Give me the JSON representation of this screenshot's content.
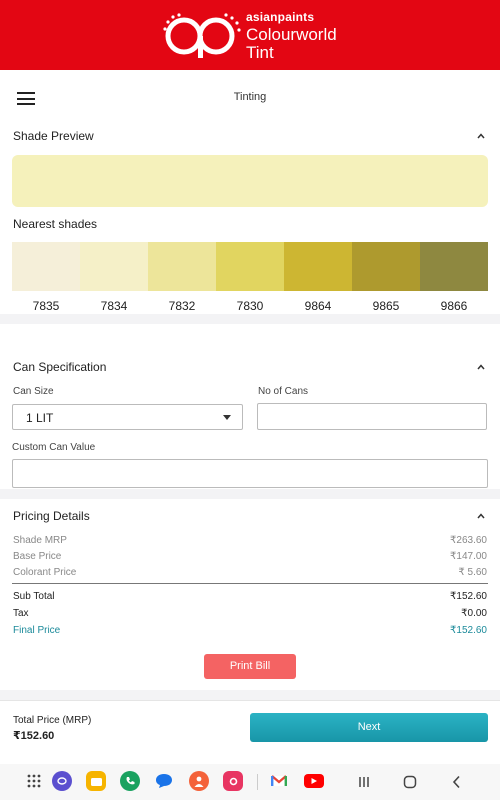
{
  "brand": {
    "line1": "asianpaints",
    "line2": "Colourworld",
    "line3": "Tint",
    "color": "#e30613"
  },
  "appbar": {
    "menu_icon": "hamburger-menu-icon",
    "title": "Tinting"
  },
  "shade_preview": {
    "heading": "Shade Preview",
    "collapse_icon": "chevron-up-icon",
    "preview_color": "#f5f1bb",
    "nearest_heading": "Nearest shades",
    "nearest_shades": [
      {
        "code": "7835",
        "color": "#f5efd9"
      },
      {
        "code": "7834",
        "color": "#f5f0c8"
      },
      {
        "code": "7832",
        "color": "#ede59a"
      },
      {
        "code": "7830",
        "color": "#e1d560"
      },
      {
        "code": "9864",
        "color": "#cdb632"
      },
      {
        "code": "9865",
        "color": "#ae9a2e"
      },
      {
        "code": "9866",
        "color": "#8e8840"
      }
    ]
  },
  "can_spec": {
    "heading": "Can Specification",
    "collapse_icon": "chevron-up-icon",
    "can_size_label": "Can Size",
    "can_size_value": "1 LIT",
    "no_of_cans_label": "No of Cans",
    "no_of_cans_value": "",
    "custom_label": "Custom Can Value",
    "custom_value": ""
  },
  "pricing": {
    "heading": "Pricing Details",
    "collapse_icon": "chevron-up-icon",
    "shade_mrp_label": "Shade MRP",
    "shade_mrp": "₹263.60",
    "base_price_label": "Base Price",
    "base_price": "₹147.00",
    "colorant_label": "Colorant Price",
    "colorant_price": "₹ 5.60",
    "subtotal_label": "Sub Total",
    "subtotal": "₹152.60",
    "tax_label": "Tax",
    "tax": "₹0.00",
    "final_label": "Final Price",
    "final_price": "₹152.60",
    "accent_color": "#1b8a9a"
  },
  "actions": {
    "print_label": "Print Bill",
    "print_color": "#f46363",
    "next_label": "Next"
  },
  "footer": {
    "total_label": "Total Price (MRP)",
    "total_value": "₹152.60"
  },
  "system_nav": {
    "dock_icons": [
      "app-drawer-icon",
      "galaxy-store-icon",
      "my-files-icon",
      "phone-icon",
      "messages-icon",
      "contacts-icon",
      "camera-icon",
      "gmail-icon",
      "youtube-icon"
    ],
    "nav_icons": [
      "recents-icon",
      "home-icon",
      "back-icon"
    ]
  }
}
